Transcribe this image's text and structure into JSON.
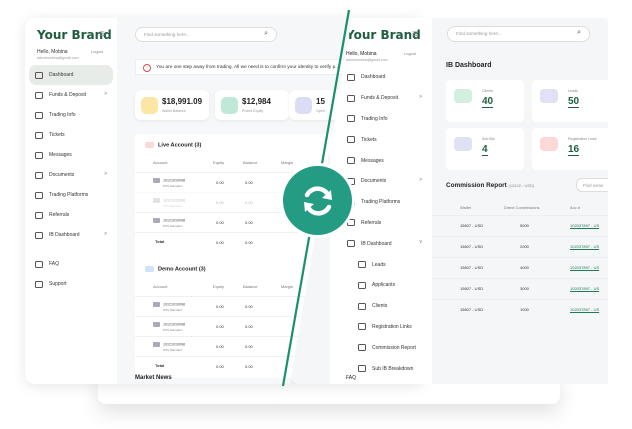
{
  "brand": "Your Brand",
  "user": {
    "greeting": "Hello, Mobina",
    "logout": "Logout",
    "email": "adminmobina@gmail.com"
  },
  "left": {
    "search_placeholder": "Find something here...",
    "nav": [
      {
        "label": "Dashboard",
        "active": true,
        "chev": ""
      },
      {
        "label": "Funds & Deposit",
        "chev": ">"
      },
      {
        "label": "Trading Info",
        "chev": ""
      },
      {
        "label": "Tickets",
        "chev": ""
      },
      {
        "label": "Messages",
        "chev": ""
      },
      {
        "label": "Documents",
        "chev": ">"
      },
      {
        "label": "Trading Platforms",
        "chev": ""
      },
      {
        "label": "Referrals",
        "chev": ""
      },
      {
        "label": "IB Dashboard",
        "chev": ">"
      }
    ],
    "foot": [
      {
        "label": "FAQ"
      },
      {
        "label": "Support"
      }
    ],
    "alert": "You are one step away from trading. All we need is to confirm your identity to verify p...",
    "stats": [
      {
        "value": "$18,991.09",
        "label": "Wallet Balance",
        "color": "#fbe7a5"
      },
      {
        "value": "$12,984",
        "label": "Prized Equity",
        "color": "#bfe9d6"
      },
      {
        "value": "15",
        "label": "Open",
        "color": "#dcdcf6"
      }
    ],
    "live": {
      "title": "Live Account (3)",
      "headers": [
        "Account",
        "Equity",
        "Balance",
        "Margin"
      ],
      "rows": [
        {
          "acct": "10121010098",
          "sub": "MT5 Standard",
          "eq": "0.00",
          "bal": "0.00",
          "faded": false
        },
        {
          "acct": "10121010098",
          "sub": "MT5 Standard",
          "eq": "0.00",
          "bal": "0.00",
          "faded": true
        },
        {
          "acct": "10121010098",
          "sub": "MT5 Standard",
          "eq": "0.00",
          "bal": "0.00",
          "faded": false
        }
      ],
      "total": "Total",
      "total_eq": "0.00",
      "total_bal": "0.00"
    },
    "demo": {
      "title": "Demo Account (3)",
      "headers": [
        "Account",
        "Equity",
        "Balance",
        "Margin"
      ],
      "rows": [
        {
          "acct": "10121010098",
          "sub": "MT5 Standard",
          "eq": "0.00",
          "bal": "0.00",
          "faded": false
        },
        {
          "acct": "10121010098",
          "sub": "MT5 Standard",
          "eq": "0.00",
          "bal": "0.00",
          "faded": false
        },
        {
          "acct": "10121010098",
          "sub": "MT5 Standard",
          "eq": "0.00",
          "bal": "0.00",
          "faded": false
        }
      ],
      "total": "Total",
      "total_eq": "0.00",
      "total_bal": "0.00"
    },
    "news": "Market News"
  },
  "right": {
    "search_placeholder": "Find something here...",
    "nav": [
      {
        "label": "Dashboard",
        "chev": ""
      },
      {
        "label": "Funds & Deposit",
        "chev": ">"
      },
      {
        "label": "Trading Info",
        "chev": ""
      },
      {
        "label": "Tickets",
        "chev": ""
      },
      {
        "label": "Messages",
        "chev": ""
      },
      {
        "label": "Documents",
        "chev": ">"
      },
      {
        "label": "Trading Platforms",
        "chev": ""
      },
      {
        "label": "Referrals",
        "chev": ""
      },
      {
        "label": "IB Dashboard",
        "chev": "v"
      }
    ],
    "subnav": [
      {
        "label": "Leads"
      },
      {
        "label": "Applicants"
      },
      {
        "label": "Clients"
      },
      {
        "label": "Registration Links"
      },
      {
        "label": "Commission Report"
      },
      {
        "label": "Sub IB Breakdown"
      }
    ],
    "faq": "FAQ",
    "ib_title": "IB Dashboard",
    "ib_cards": [
      {
        "label": "Clients",
        "value": "40",
        "color": "#d2efdf"
      },
      {
        "label": "Leads",
        "value": "50",
        "color": "#e1e1f6"
      },
      {
        "label": "Sub IBs",
        "value": "4",
        "color": "#e1e1f6"
      },
      {
        "label": "Registration Links",
        "value": "16",
        "color": "#fbd9d9"
      }
    ],
    "comm_title": "Commission Report",
    "comm_range": "(12422 - USD)",
    "find": "Find some",
    "comm_headers": [
      "Wallet",
      "Direct Commissions",
      "Acc #"
    ],
    "comm_rows": [
      {
        "wallet": "15607 - USD",
        "comm": "5000",
        "acc": "102037897 - US"
      },
      {
        "wallet": "15607 - USD",
        "comm": "2000",
        "acc": "102037897 - US"
      },
      {
        "wallet": "15607 - USD",
        "comm": "4000",
        "acc": "102037897 - US"
      },
      {
        "wallet": "15607 - USD",
        "comm": "3000",
        "acc": "102037897 - US"
      },
      {
        "wallet": "15607 - USD",
        "comm": "1000",
        "acc": "102037897 - US"
      }
    ]
  },
  "colors": {
    "brand": "#1e5e3d",
    "divider": "#1b8f6e",
    "sync": "#239c83"
  }
}
